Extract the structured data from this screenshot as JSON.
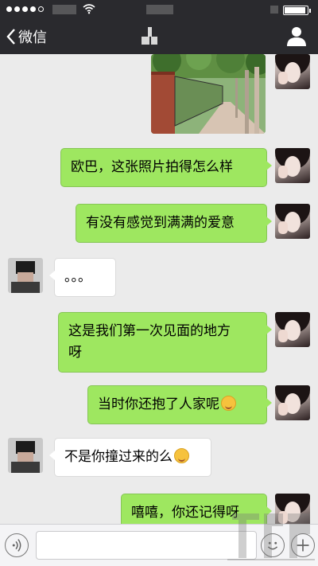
{
  "nav": {
    "back_label": "微信"
  },
  "messages": [
    {
      "from": "me",
      "kind": "image"
    },
    {
      "from": "me",
      "text": "欧巴，这张照片拍得怎么样"
    },
    {
      "from": "me",
      "text": "有没有感觉到满满的爱意"
    },
    {
      "from": "them",
      "text": "。。。"
    },
    {
      "from": "me",
      "text": "这是我们第一次见面的地方\n呀"
    },
    {
      "from": "me",
      "text": "当时你还抱了人家呢",
      "emoji": "smile-emoji"
    },
    {
      "from": "them",
      "text": "不是你撞过来的么",
      "emoji": "grin-emoji"
    },
    {
      "from": "me",
      "text": "嘻嘻，你还记得呀"
    }
  ],
  "input": {
    "value": ""
  },
  "colors": {
    "navbar": "#2a2a2e",
    "background": "#ebebeb",
    "my_bubble": "#9ee760",
    "their_bubble": "#ffffff"
  },
  "icons": [
    "signal-dots-icon",
    "wifi-icon",
    "battery-icon",
    "chevron-left-icon",
    "contact-profile-icon",
    "voice-icon",
    "emoji-icon",
    "plus-icon"
  ],
  "watermark_text": "Xiazaiba.com"
}
